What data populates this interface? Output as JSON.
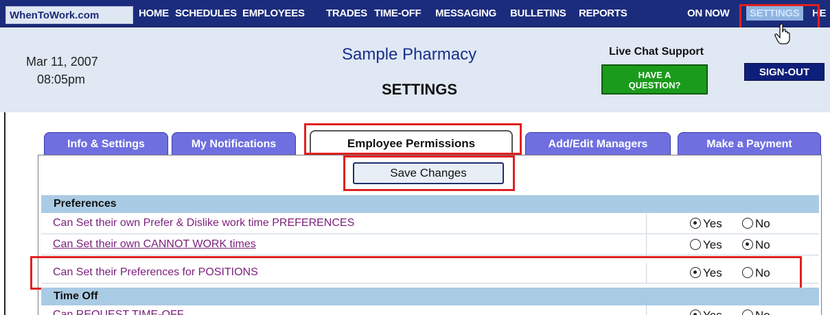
{
  "nav": {
    "logo": "WhenToWork.com",
    "items": [
      {
        "label": "HOME",
        "active": false
      },
      {
        "label": "SCHEDULES",
        "active": false
      },
      {
        "label": "EMPLOYEES",
        "active": false
      },
      {
        "label": "TRADES",
        "active": false
      },
      {
        "label": "TIME-OFF",
        "active": false
      },
      {
        "label": "MESSAGING",
        "active": false
      },
      {
        "label": "BULLETINS",
        "active": false
      },
      {
        "label": "REPORTS",
        "active": false
      },
      {
        "label": "ON NOW",
        "active": false
      },
      {
        "label": "SETTINGS",
        "active": true
      },
      {
        "label": "HE",
        "active": false
      }
    ]
  },
  "header": {
    "date": "Mar 11, 2007",
    "time": "08:05pm",
    "company": "Sample Pharmacy",
    "page_title": "SETTINGS",
    "live_chat": "Live Chat Support",
    "question_line1": "HAVE A",
    "question_line2": "QUESTION?",
    "signout": "SIGN-OUT"
  },
  "tabs": [
    {
      "label": "Info & Settings",
      "active": false
    },
    {
      "label": "My Notifications",
      "active": false
    },
    {
      "label": "Employee Permissions",
      "active": true
    },
    {
      "label": "Add/Edit Managers",
      "active": false
    },
    {
      "label": "Make a Payment",
      "active": false
    }
  ],
  "save_button": "Save Changes",
  "sections": [
    {
      "title": "Preferences",
      "rows": [
        {
          "label": "Can Set their own Prefer & Dislike work time PREFERENCES",
          "value": "Yes"
        },
        {
          "label": "Can Set their own CANNOT WORK times",
          "value": "No"
        },
        {
          "label": "Can Set their Preferences for POSITIONS",
          "value": "Yes"
        }
      ]
    },
    {
      "title": "Time Off",
      "rows": [
        {
          "label": "Can REQUEST TIME-OFF",
          "value": "Yes"
        }
      ]
    }
  ],
  "options": {
    "yes": "Yes",
    "no": "No"
  },
  "colors": {
    "nav_bg": "#1c2c7c",
    "tab_bg": "#6f6fe0",
    "section_bg": "#aacbe4",
    "highlight": "#e02020",
    "question_bg": "#1b9b1b"
  }
}
